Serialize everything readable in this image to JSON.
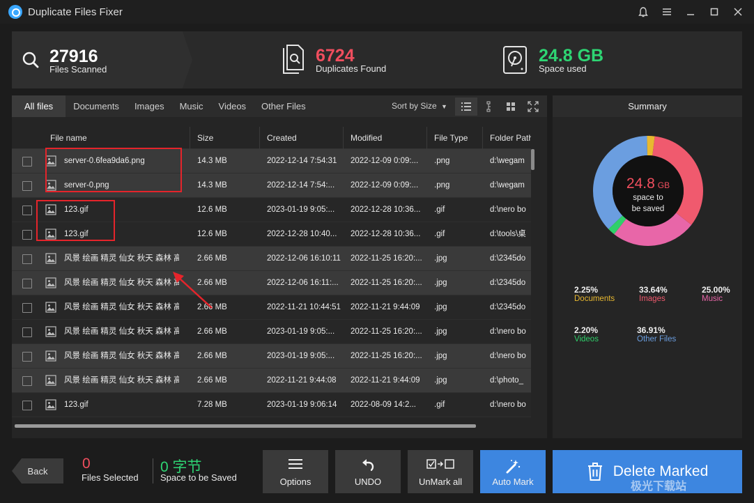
{
  "titlebar": {
    "title": "Duplicate Files Fixer",
    "icons": [
      "bell-icon",
      "menu-icon",
      "minimize-icon",
      "maximize-icon",
      "close-icon"
    ]
  },
  "stats": {
    "scanned": {
      "value": "27916",
      "label": "Files Scanned"
    },
    "duplicates": {
      "value": "6724",
      "label": "Duplicates Found"
    },
    "space": {
      "value": "24.8 GB",
      "label": "Space used"
    }
  },
  "tabs": [
    "All files",
    "Documents",
    "Images",
    "Music",
    "Videos",
    "Other Files"
  ],
  "sort_label": "Sort by Size",
  "columns": [
    "File name",
    "Size",
    "Created",
    "Modified",
    "File Type",
    "Folder Path"
  ],
  "rows": [
    {
      "name": "server-0.6fea9da6.png",
      "size": "14.3 MB",
      "created": "2022-12-14 7:54:31",
      "modified": "2022-12-09 0:09:...",
      "type": ".png",
      "path": "d:\\wegam"
    },
    {
      "name": "server-0.png",
      "size": "14.3 MB",
      "created": "2022-12-14 7:54:...",
      "modified": "2022-12-09 0:09:...",
      "type": ".png",
      "path": "d:\\wegam"
    },
    {
      "name": "123.gif",
      "size": "12.6 MB",
      "created": "2023-01-19 9:05:...",
      "modified": "2022-12-28 10:36...",
      "type": ".gif",
      "path": "d:\\nero bo"
    },
    {
      "name": "123.gif",
      "size": "12.6 MB",
      "created": "2022-12-28 10:40...",
      "modified": "2022-12-28 10:36...",
      "type": ".gif",
      "path": "d:\\tools\\桌"
    },
    {
      "name": "风景 绘画 精灵 仙女 秋天 森林 高...",
      "size": "2.66 MB",
      "created": "2022-12-06 16:10:11",
      "modified": "2022-11-25 16:20:...",
      "type": ".jpg",
      "path": "d:\\2345do"
    },
    {
      "name": "风景 绘画 精灵 仙女 秋天 森林 高...",
      "size": "2.66 MB",
      "created": "2022-12-06 16:11:...",
      "modified": "2022-11-25 16:20:...",
      "type": ".jpg",
      "path": "d:\\2345do"
    },
    {
      "name": "风景 绘画 精灵 仙女 秋天 森林 高...",
      "size": "2.66 MB",
      "created": "2022-11-21 10:44:51",
      "modified": "2022-11-21 9:44:09",
      "type": ".jpg",
      "path": "d:\\2345do"
    },
    {
      "name": "风景 绘画 精灵 仙女 秋天 森林 高...",
      "size": "2.66 MB",
      "created": "2023-01-19 9:05:...",
      "modified": "2022-11-25 16:20:...",
      "type": ".jpg",
      "path": "d:\\nero bo"
    },
    {
      "name": "风景 绘画 精灵 仙女 秋天 森林 高...",
      "size": "2.66 MB",
      "created": "2023-01-19 9:05:...",
      "modified": "2022-11-25 16:20:...",
      "type": ".jpg",
      "path": "d:\\nero bo"
    },
    {
      "name": "风景 绘画 精灵 仙女 秋天 森林 高...",
      "size": "2.66 MB",
      "created": "2022-11-21 9:44:08",
      "modified": "2022-11-21 9:44:09",
      "type": ".jpg",
      "path": "d:\\photo_"
    },
    {
      "name": "123.gif",
      "size": "7.28 MB",
      "created": "2023-01-19 9:06:14",
      "modified": "2022-08-09 14:2...",
      "type": ".gif",
      "path": "d:\\nero bo"
    }
  ],
  "summary": {
    "title": "Summary",
    "center_value": "24.8",
    "center_unit": "GB",
    "center_line1": "space to",
    "center_line2": "be saved",
    "legend": [
      {
        "pct": "2.25%",
        "name": "Documents",
        "color": "#e8b830"
      },
      {
        "pct": "33.64%",
        "name": "Images",
        "color": "#f05a6e"
      },
      {
        "pct": "25.00%",
        "name": "Music",
        "color": "#e866a8"
      },
      {
        "pct": "2.20%",
        "name": "Videos",
        "color": "#2fd06a"
      },
      {
        "pct": "36.91%",
        "name": "Other Files",
        "color": "#6b9ee0"
      }
    ]
  },
  "bottom": {
    "back": "Back",
    "selected_value": "0",
    "selected_label": "Files Selected",
    "saved_value": "0 字节",
    "saved_label": "Space to be Saved",
    "options": "Options",
    "undo": "UNDO",
    "unmark": "UnMark all",
    "automark": "Auto Mark",
    "delete": "Delete Marked"
  },
  "watermark": "极光下载站",
  "colors": {
    "accent": "#3d86e0",
    "red": "#f04e5e",
    "green": "#2ed573"
  }
}
